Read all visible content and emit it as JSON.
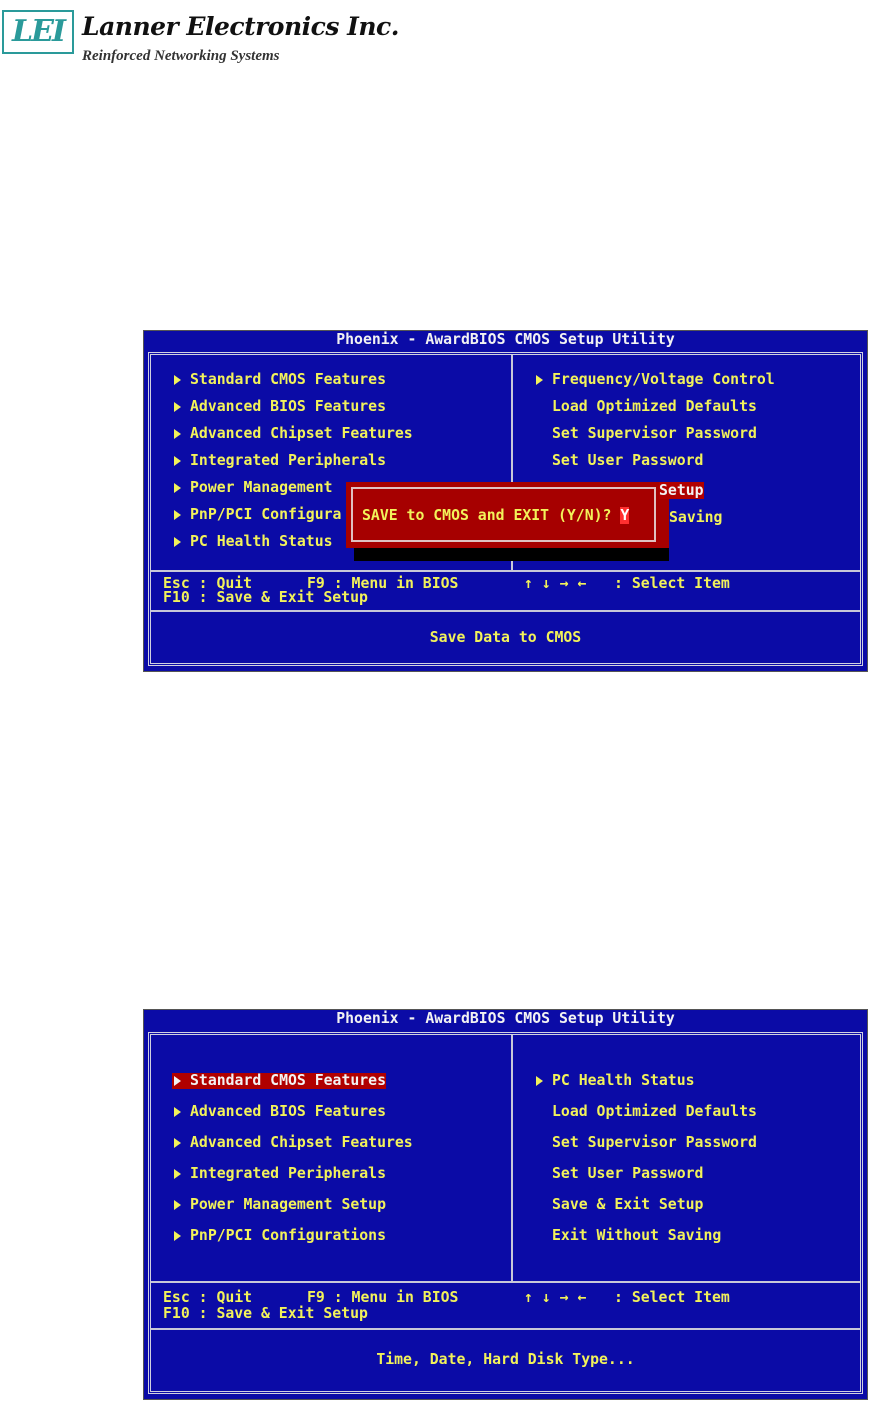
{
  "logo": {
    "mark": "LEI",
    "company": "Lanner Electronics Inc.",
    "tagline": "Reinforced Networking Systems"
  },
  "colors": {
    "bios_bg": "#0b0ba6",
    "text": "#f2f25a",
    "highlight": "#b00000",
    "dialog": "#a60000"
  },
  "screen1": {
    "title": "Phoenix - AwardBIOS CMOS Setup Utility",
    "left_items": [
      "Standard CMOS Features",
      "Advanced BIOS Features",
      "Advanced Chipset Features",
      "Integrated Peripherals",
      "Power Management",
      "PnP/PCI Configura",
      "PC Health Status"
    ],
    "right_items": [
      "Frequency/Voltage Control",
      "Load Optimized Defaults",
      "Set Supervisor Password",
      "Set User Password",
      "Setup",
      "Saving"
    ],
    "dialog": {
      "prompt": "SAVE to CMOS and EXIT (Y/N)? ",
      "value": "Y"
    },
    "footer": {
      "esc": "Esc : Quit",
      "f9": "F9 : Menu in BIOS",
      "arrows": "↑ ↓ → ←",
      "select": ": Select Item",
      "f10": "F10 : Save & Exit Setup"
    },
    "status": "Save Data to CMOS"
  },
  "screen2": {
    "title": "Phoenix - AwardBIOS CMOS Setup Utility",
    "left_items": [
      "Standard CMOS Features",
      "Advanced BIOS Features",
      "Advanced Chipset Features",
      "Integrated Peripherals",
      "Power Management Setup",
      "PnP/PCI Configurations"
    ],
    "right_items": [
      "PC Health Status",
      "Load Optimized Defaults",
      "Set Supervisor Password",
      "Set User Password",
      "Save & Exit Setup",
      "Exit Without Saving"
    ],
    "selected": "Standard CMOS Features",
    "footer": {
      "esc": "Esc : Quit",
      "f9": "F9 : Menu in BIOS",
      "arrows": "↑ ↓ → ←",
      "select": ": Select Item",
      "f10": "F10 : Save & Exit Setup"
    },
    "status": "Time, Date, Hard Disk Type..."
  }
}
